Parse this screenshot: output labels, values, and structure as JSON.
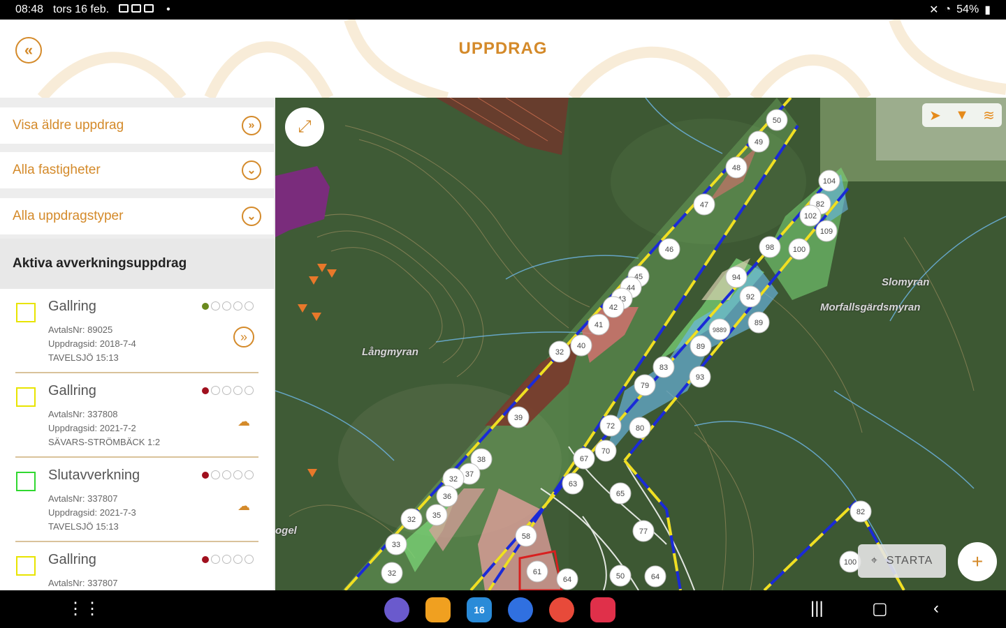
{
  "status_bar": {
    "time": "08:48",
    "date": "tors 16 feb.",
    "dot": "•",
    "battery": "54%"
  },
  "header": {
    "title": "UPPDRAG",
    "back_icon": "double-chevron-left-icon"
  },
  "sidebar": {
    "filters": [
      {
        "label": "Visa äldre uppdrag",
        "icon": "double-chevron-right-icon",
        "glyph": "»"
      },
      {
        "label": "Alla fastigheter",
        "icon": "double-chevron-down-icon",
        "glyph": "⌄"
      },
      {
        "label": "Alla uppdragstyper",
        "icon": "double-chevron-down-icon",
        "glyph": "⌄"
      }
    ],
    "section_title": "Aktiva avverkningsuppdrag",
    "items": [
      {
        "name": "Gallring",
        "avtal": "AvtalsNr: 89025",
        "uppdrag": "Uppdragsid: 2018-7-4",
        "fastighet": "TAVELSJÖ 15:13",
        "status_color": "#6a8a1e",
        "checkbox_color": "#e8e400",
        "action_icon": "double-chevron-right-icon",
        "action_glyph": "»"
      },
      {
        "name": "Gallring",
        "avtal": "AvtalsNr: 337808",
        "uppdrag": "Uppdragsid: 2021-7-2",
        "fastighet": "SÄVARS-STRÖMBÄCK 1:2",
        "status_color": "#a0101e",
        "checkbox_color": "#e8e400",
        "action_icon": "cloud-download-icon",
        "action_glyph": "☁"
      },
      {
        "name": "Slutavverkning",
        "avtal": "AvtalsNr: 337807",
        "uppdrag": "Uppdragsid: 2021-7-3",
        "fastighet": "TAVELSJÖ 15:13",
        "status_color": "#a0101e",
        "checkbox_color": "#30d830",
        "action_icon": "cloud-download-icon",
        "action_glyph": "☁"
      },
      {
        "name": "Gallring",
        "avtal": "AvtalsNr: 337807",
        "uppdrag": "",
        "fastighet": "",
        "status_color": "#a0101e",
        "checkbox_color": "#e8e400",
        "action_icon": "cloud-download-icon",
        "action_glyph": "☁"
      }
    ]
  },
  "map": {
    "expand_icon": "expand-arrows-icon",
    "tools": [
      "navigation-arrow-icon",
      "filter-icon",
      "layers-icon"
    ],
    "places": [
      "Slomyran",
      "Morfallsgärdsmyran",
      "Långmyran",
      "ogel"
    ],
    "starta_label": "STARTA",
    "starta_icon": "gps-icon",
    "fab_icon": "plus-icon",
    "stand_numbers_a": [
      "50",
      "49",
      "48",
      "47",
      "46",
      "45",
      "44",
      "43",
      "42",
      "41",
      "40",
      "32",
      "39",
      "38",
      "37",
      "32",
      "36",
      "35",
      "32",
      "33",
      "32"
    ],
    "stand_numbers_b": [
      "104",
      "82",
      "102",
      "109",
      "98",
      "100",
      "94",
      "92",
      "9889",
      "89",
      "89",
      "83",
      "93",
      "79",
      "72",
      "80",
      "70",
      "67",
      "63",
      "65",
      "77",
      "58",
      "61",
      "64",
      "50",
      "64",
      "82",
      "100"
    ]
  },
  "navbar": {
    "apps": [
      "internet-app-icon",
      "files-app-icon",
      "calendar-app-icon",
      "messages-app-icon",
      "contacts-app-icon",
      "screen-recorder-app-icon"
    ],
    "app_colors": [
      "#6a5acd",
      "#f0a020",
      "#2a8bd8",
      "#3070e0",
      "#e84a3a",
      "#e0304a"
    ],
    "calendar_day": "16",
    "system": [
      "recent-apps-icon",
      "home-icon",
      "back-icon"
    ]
  },
  "colors": {
    "accent": "#d48a2a",
    "map_bg": "#3f5a35"
  }
}
